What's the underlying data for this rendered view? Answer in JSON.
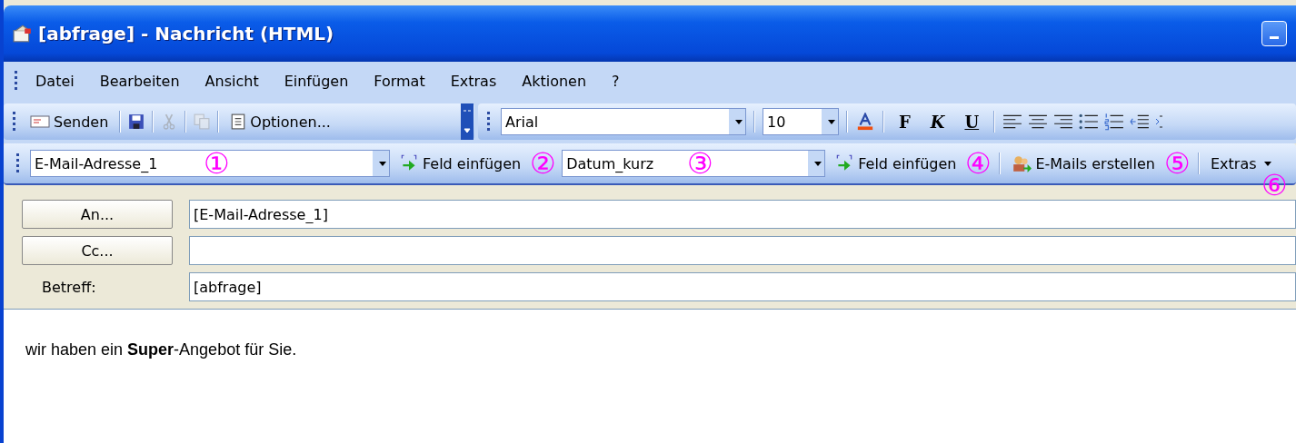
{
  "window": {
    "title": "[abfrage] - Nachricht (HTML)"
  },
  "menu": [
    "Datei",
    "Bearbeiten",
    "Ansicht",
    "Einfügen",
    "Format",
    "Extras",
    "Aktionen",
    "?"
  ],
  "standard_toolbar": {
    "send": "Senden",
    "options": "Optionen..."
  },
  "format_toolbar": {
    "font": "Arial",
    "size": "10",
    "bold": "F",
    "italic": "K",
    "underline": "U"
  },
  "merge_toolbar": {
    "field_combo": "E-Mail-Adresse_1",
    "insert_field_1": "Feld einfügen",
    "date_combo": "Datum_kurz",
    "insert_field_2": "Feld einfügen",
    "create_mails": "E-Mails erstellen",
    "extras": "Extras"
  },
  "callouts": [
    "①",
    "②",
    "③",
    "④",
    "⑤",
    "⑥"
  ],
  "header": {
    "to_button": "An...",
    "to_value": "[E-Mail-Adresse_1]",
    "cc_button": "Cc...",
    "subject_label": "Betreff:",
    "subject_value": "[abfrage]"
  },
  "body": "wir haben ein **Super**-Angebot für Sie."
}
